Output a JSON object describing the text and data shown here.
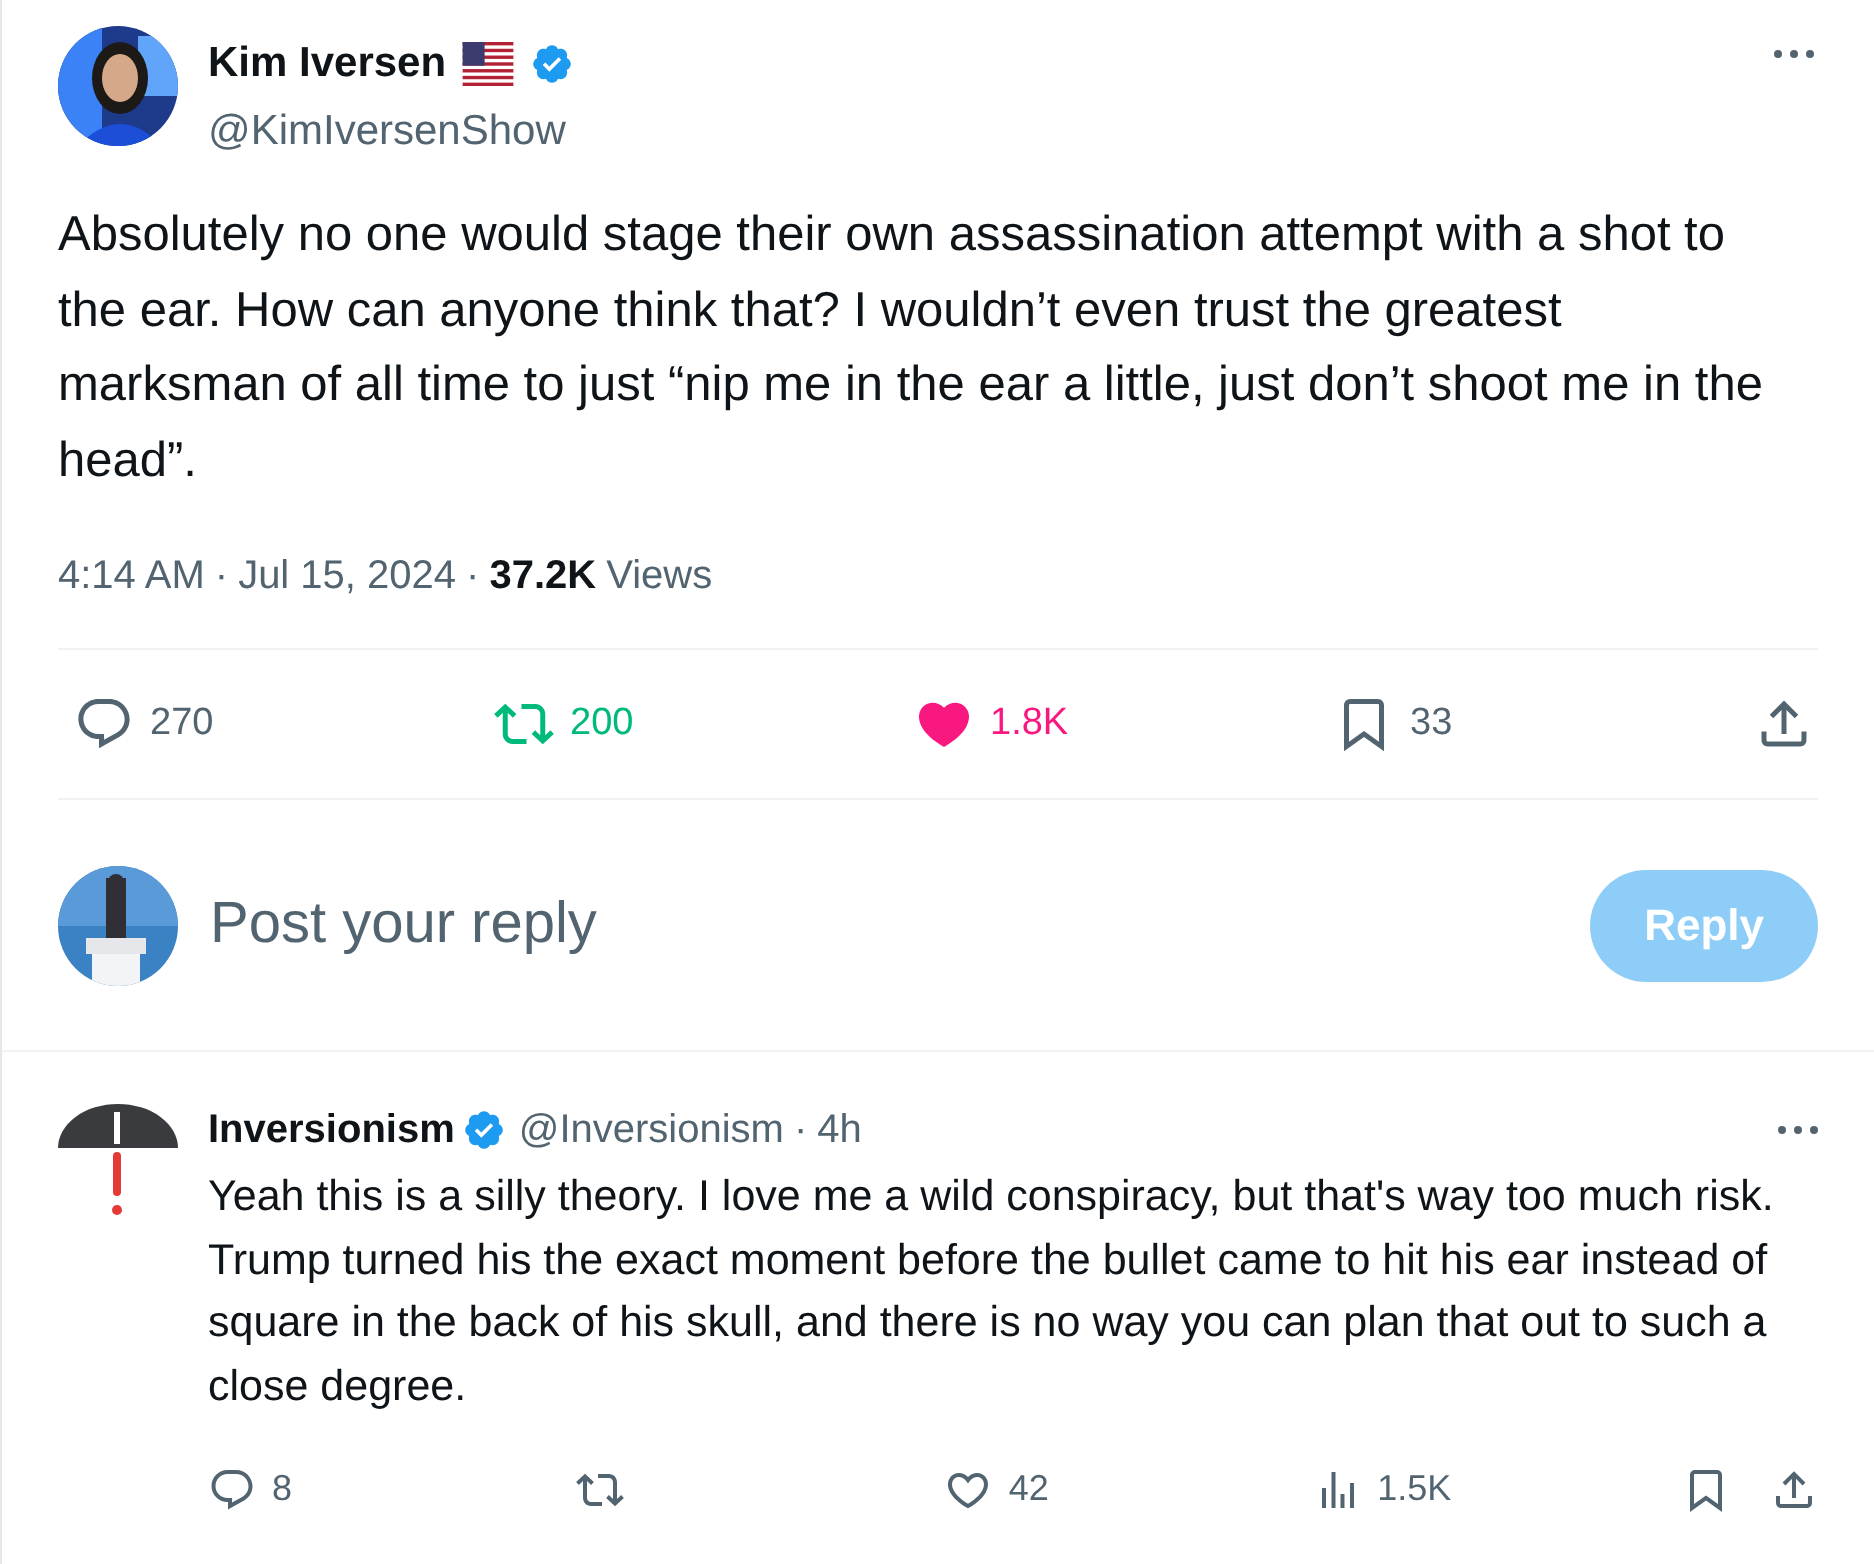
{
  "tweet": {
    "author": {
      "name": "Kim Iversen",
      "handle": "@KimIversenShow",
      "verified": true,
      "flag": true
    },
    "text": "Absolutely no one would stage their own assassination attempt with a shot to the ear. How can anyone think that? I wouldn’t even trust the greatest marksman of all time to just “nip me in the ear a little, just don’t shoot me in the head”.",
    "time": "4:14 AM",
    "separator": "·",
    "date": "Jul 15, 2024",
    "views_count": "37.2K",
    "views_label": "Views",
    "actions": [
      {
        "kind": "reply",
        "count": "270"
      },
      {
        "kind": "retweet",
        "count": "200",
        "active": true
      },
      {
        "kind": "like",
        "count": "1.8K",
        "active": true
      },
      {
        "kind": "bookmark",
        "count": "33"
      },
      {
        "kind": "share"
      }
    ]
  },
  "composer": {
    "placeholder": "Post your reply",
    "button": "Reply",
    "disabled": true
  },
  "replies": [
    {
      "name": "Inversionism",
      "handle": "@Inversionism",
      "separator": "·",
      "age": "4h",
      "verified": true,
      "text": "Yeah this is a silly theory. I love me a wild conspiracy, but that's way too much risk. Trump turned his the exact moment before the bullet came to hit his ear instead of square in the back of his skull, and there is no way you can plan that out to such a close degree.",
      "actions": [
        {
          "kind": "reply",
          "count": "8"
        },
        {
          "kind": "retweet",
          "active": false
        },
        {
          "kind": "like",
          "count": "42",
          "active": false
        },
        {
          "kind": "views",
          "count": "1.5K"
        },
        {
          "kind": "bookmark"
        },
        {
          "kind": "share"
        }
      ]
    }
  ]
}
